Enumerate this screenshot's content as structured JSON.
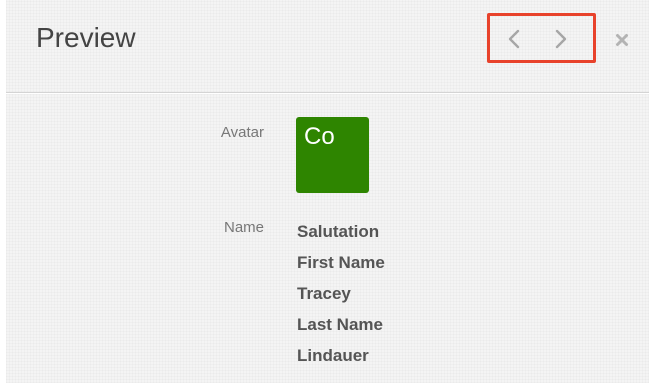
{
  "header": {
    "title": "Preview",
    "prev_icon": "chevron-left-icon",
    "next_icon": "chevron-right-icon",
    "close_icon": "close-icon"
  },
  "fields": {
    "avatar": {
      "label": "Avatar",
      "initials": "Co",
      "color": "#2e8500"
    },
    "name": {
      "label": "Name",
      "lines": [
        "Salutation",
        "First Name",
        "Tracey",
        "Last Name",
        "Lindauer"
      ]
    }
  },
  "colors": {
    "highlight": "#e8422b"
  }
}
